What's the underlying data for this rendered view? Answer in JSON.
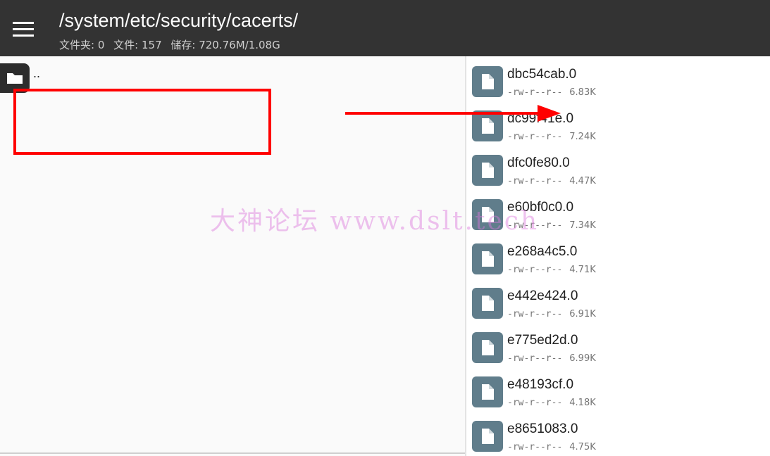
{
  "header": {
    "path": "/system/etc/security/cacerts/",
    "stats": {
      "folders": "文件夹: 0",
      "files": "文件: 157",
      "storage": "储存: 720.76M/1.08G"
    }
  },
  "left_pane": {
    "parent_label": ".."
  },
  "files": [
    {
      "name": "dbc54cab.0",
      "perm": "-rw-r--r--",
      "size": "6.83K"
    },
    {
      "name": "dc99f41e.0",
      "perm": "-rw-r--r--",
      "size": "7.24K"
    },
    {
      "name": "dfc0fe80.0",
      "perm": "-rw-r--r--",
      "size": "4.47K"
    },
    {
      "name": "e60bf0c0.0",
      "perm": "-rw-r--r--",
      "size": "7.34K"
    },
    {
      "name": "e268a4c5.0",
      "perm": "-rw-r--r--",
      "size": "4.71K"
    },
    {
      "name": "e442e424.0",
      "perm": "-rw-r--r--",
      "size": "6.91K"
    },
    {
      "name": "e775ed2d.0",
      "perm": "-rw-r--r--",
      "size": "6.99K"
    },
    {
      "name": "e48193cf.0",
      "perm": "-rw-r--r--",
      "size": "4.18K"
    },
    {
      "name": "e8651083.0",
      "perm": "-rw-r--r--",
      "size": "4.75K"
    }
  ],
  "watermark": "大神论坛   www.dslt.tech",
  "colors": {
    "header_bg": "#333333",
    "file_icon": "#607d8b",
    "annotation": "#ff0000"
  }
}
